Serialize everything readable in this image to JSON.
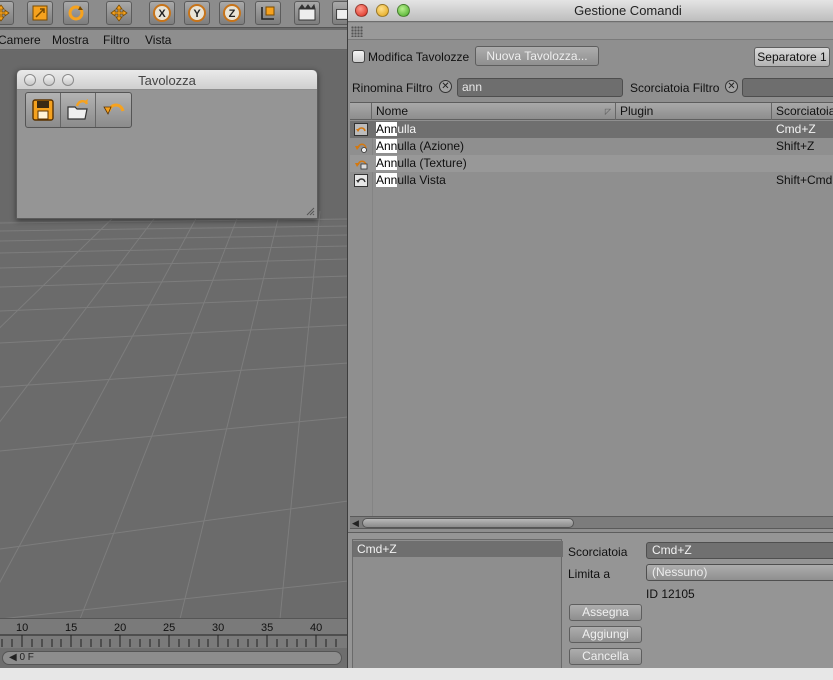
{
  "viewport": {
    "menu": [
      "Camere",
      "Mostra",
      "Filtro",
      "Vista"
    ],
    "toolbar_icons": [
      "move-icon",
      "scale-icon",
      "rotate-icon",
      "move-axis-icon",
      "x-axis-icon",
      "y-axis-icon",
      "z-axis-icon",
      "coordinate-system-icon",
      "render-view-icon"
    ],
    "ruler": [
      "10",
      "15",
      "20",
      "25",
      "30",
      "35",
      "40"
    ],
    "time_field": "◀ 0 F"
  },
  "palette": {
    "title": "Tavolozza",
    "buttons": [
      "save-icon",
      "open-icon",
      "undo-icon"
    ]
  },
  "command_manager": {
    "title": "Gestione Comandi",
    "edit_palettes_label": "Modifica Tavolozze",
    "new_palette_button": "Nuova Tavolozza...",
    "separator_button": "Separatore 1",
    "rename_filter_label": "Rinomina Filtro",
    "rename_filter_value": "ann",
    "shortcut_filter_label": "Scorciatoia Filtro",
    "shortcut_filter_value": "",
    "columns": [
      "Nome",
      "Plugin",
      "Scorciatoia"
    ],
    "rows": [
      {
        "match": "Ann",
        "rest": "ulla",
        "plugin": "",
        "shortcut": "Cmd+Z",
        "icon": "undo-icon",
        "selected": true
      },
      {
        "match": "Ann",
        "rest": "ulla (Azione)",
        "plugin": "",
        "shortcut": "Shift+Z",
        "icon": "undo-action-icon",
        "selected": false
      },
      {
        "match": "Ann",
        "rest": "ulla (Texture)",
        "plugin": "",
        "shortcut": "",
        "icon": "undo-texture-icon",
        "selected": false
      },
      {
        "match": "Ann",
        "rest": "ulla Vista",
        "plugin": "",
        "shortcut": "Shift+Cmd",
        "icon": "undo-view-icon",
        "selected": false
      }
    ],
    "shortcut_list": [
      "Cmd+Z"
    ],
    "shortcut_label": "Scorciatoia",
    "shortcut_value": "Cmd+Z",
    "limit_label": "Limita a",
    "limit_value": "(Nessuno)",
    "id_text": "ID 12105",
    "assign_button": "Assegna",
    "add_button": "Aggiungi",
    "delete_button": "Cancella"
  }
}
